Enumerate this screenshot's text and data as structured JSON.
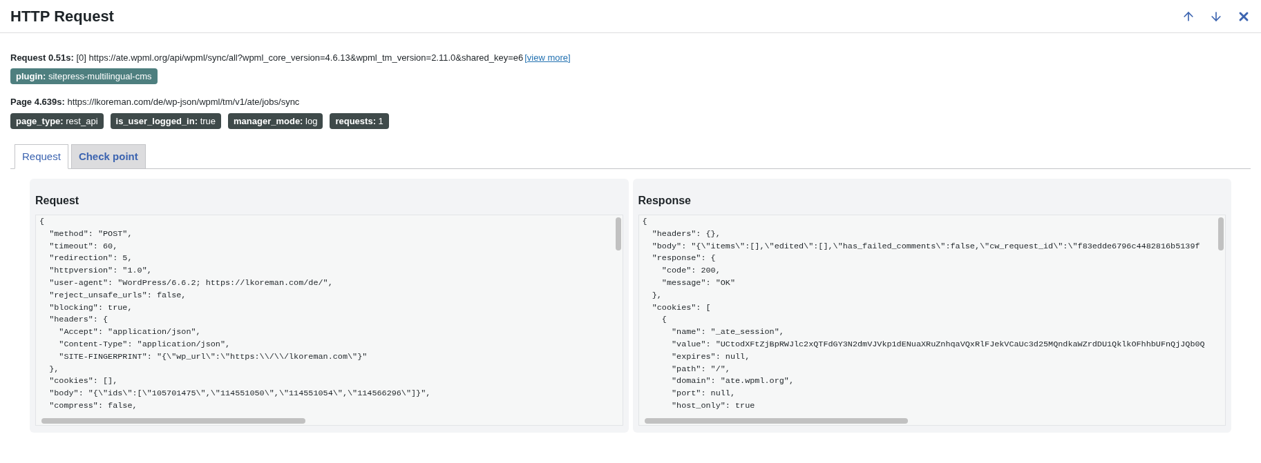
{
  "window": {
    "title": "HTTP Request",
    "actions": [
      {
        "kind": "up"
      },
      {
        "kind": "down"
      },
      {
        "kind": "close"
      }
    ]
  },
  "request_line": {
    "label": "Request 0.51s:",
    "url": "[0] https://ate.wpml.org/api/wpml/sync/all?wpml_core_version=4.6.13&wpml_tm_version=2.11.0&shared_key=e6",
    "link": "[view more]"
  },
  "request_tags": [
    {
      "key": "plugin:",
      "value": "sitepress-multilingual-cms",
      "color": "#4e7f7f"
    }
  ],
  "page_line": {
    "label": "Page 4.639s:",
    "url": "https://lkoreman.com/de/wp-json/wpml/tm/v1/ate/jobs/sync"
  },
  "page_tags": [
    {
      "key": "page_type:",
      "value": "rest_api",
      "color": "#3f4a4a"
    },
    {
      "key": "is_user_logged_in:",
      "value": "true",
      "color": "#3f4a4a"
    },
    {
      "key": "manager_mode:",
      "value": "log",
      "color": "#3f4a4a"
    },
    {
      "key": "requests:",
      "value": "1",
      "color": "#3f4a4a"
    }
  ],
  "tabs": [
    {
      "label": "Request",
      "selected": true
    },
    {
      "label": "Check point",
      "selected": false
    }
  ],
  "panels": [
    {
      "title": "Request",
      "lines": [
        "{",
        "  \"method\": \"POST\",",
        "  \"timeout\": 60,",
        "  \"redirection\": 5,",
        "  \"httpversion\": \"1.0\",",
        "  \"user-agent\": \"WordPress/6.6.2; https://lkoreman.com/de/\",",
        "  \"reject_unsafe_urls\": false,",
        "  \"blocking\": true,",
        "  \"headers\": {",
        "    \"Accept\": \"application/json\",",
        "    \"Content-Type\": \"application/json\",",
        "    \"SITE-FINGERPRINT\": \"{\\\"wp_url\\\":\\\"https:\\\\/\\\\/lkoreman.com\\\"}\"",
        "  },",
        "  \"cookies\": [],",
        "  \"body\": \"{\\\"ids\\\":[\\\"105701475\\\",\\\"114551050\\\",\\\"114551054\\\",\\\"114566296\\\"]}\",",
        "  \"compress\": false,"
      ]
    },
    {
      "title": "Response",
      "lines": [
        "{",
        "  \"headers\": {},",
        "  \"body\": \"{\\\"items\\\":[],\\\"edited\\\":[],\\\"has_failed_comments\\\":false,\\\"cw_request_id\\\":\\\"f83edde6796c4482816b5139f",
        "  \"response\": {",
        "    \"code\": 200,",
        "    \"message\": \"OK\"",
        "  },",
        "  \"cookies\": [",
        "    {",
        "      \"name\": \"_ate_session\",",
        "      \"value\": \"UCtodXFtZjBpRWJlc2xQTFdGY3N2dmVJVkp1dENuaXRuZnhqaVQxRlFJekVCaUc3d25MQndkaWZrdDU1QklkOFhhbUFnQjJQb0Q",
        "      \"expires\": null,",
        "      \"path\": \"/\",",
        "      \"domain\": \"ate.wpml.org\",",
        "      \"port\": null,",
        "      \"host_only\": true"
      ]
    }
  ]
}
